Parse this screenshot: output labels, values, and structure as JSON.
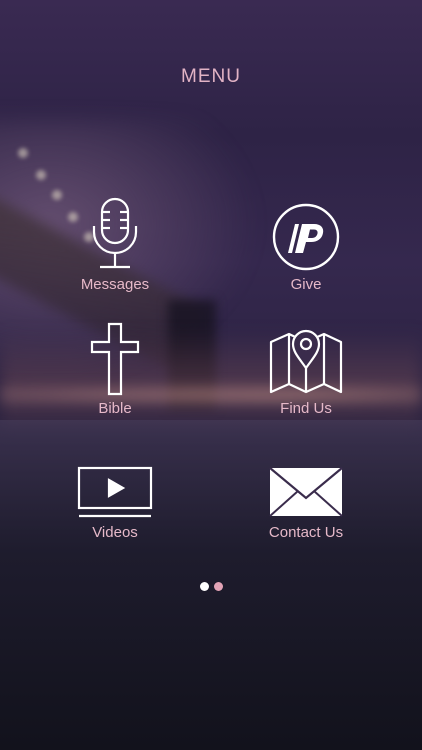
{
  "menu": {
    "title": "MENU",
    "items": [
      {
        "label": "Messages",
        "icon": "microphone-icon"
      },
      {
        "label": "Give",
        "icon": "p-logo-icon"
      },
      {
        "label": "Bible",
        "icon": "cross-icon"
      },
      {
        "label": "Find Us",
        "icon": "map-pin-icon"
      },
      {
        "label": "Videos",
        "icon": "video-screen-icon"
      },
      {
        "label": "Contact Us",
        "icon": "envelope-icon"
      }
    ]
  },
  "pager": {
    "pages": 2,
    "active_index": 0,
    "active_color": "#ffffff",
    "inactive_color": "#e2a3b6"
  },
  "colors": {
    "label": "#e6b9c9",
    "icon": "#ffffff"
  }
}
